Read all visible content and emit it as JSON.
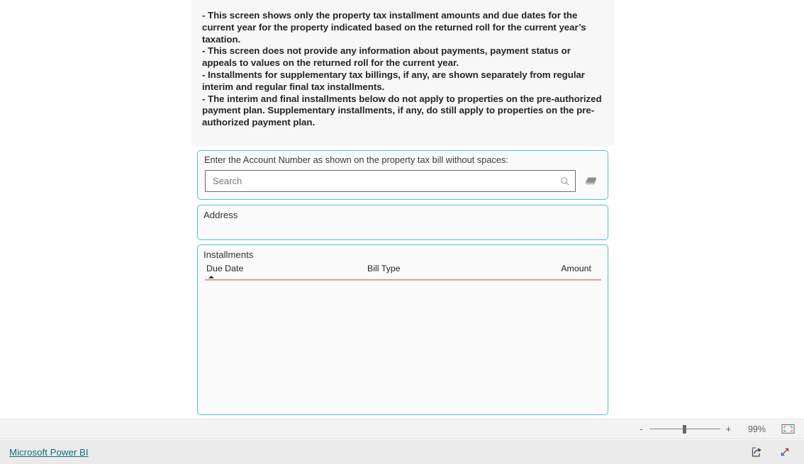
{
  "notes": {
    "lines": [
      "- This screen shows only the property tax installment amounts and due dates for the current year for the property indicated based on the returned roll for the current year’s taxation.",
      "- This screen does not provide any information about payments, payment status or appeals to values on the returned roll for the current year.",
      "- Installments for supplementary tax billings, if any, are shown separately from regular interim and regular final tax installments.",
      "- The interim and final installments below do not apply to properties on the pre-authorized payment plan. Supplementary installments, if any, do still apply to properties on the pre-authorized payment plan."
    ]
  },
  "search_slicer": {
    "title": "Enter the Account Number as shown on the property tax bill without spaces:",
    "input_value": "",
    "placeholder": "Search",
    "search_icon": "search-icon",
    "clear_icon": "eraser-icon"
  },
  "address_card": {
    "title": "Address",
    "value": ""
  },
  "installments_table": {
    "title": "Installments",
    "columns": [
      "Due Date",
      "Bill Type",
      "Amount"
    ],
    "sort_column": "Due Date",
    "sort_direction": "ascending",
    "rows": []
  },
  "zoom_bar": {
    "minus_label": "-",
    "plus_label": "+",
    "level": "99%",
    "fit_icon": "fit-to-page-icon"
  },
  "footer": {
    "brand": "Microsoft Power BI",
    "share_icon": "share-icon",
    "fullscreen_icon": "full-screen-icon"
  },
  "colors": {
    "visual_border": "#56c0ce",
    "table_rule": "#ed9a9a",
    "brand_link": "#12707a",
    "notes_background": "#f7f7f7"
  }
}
